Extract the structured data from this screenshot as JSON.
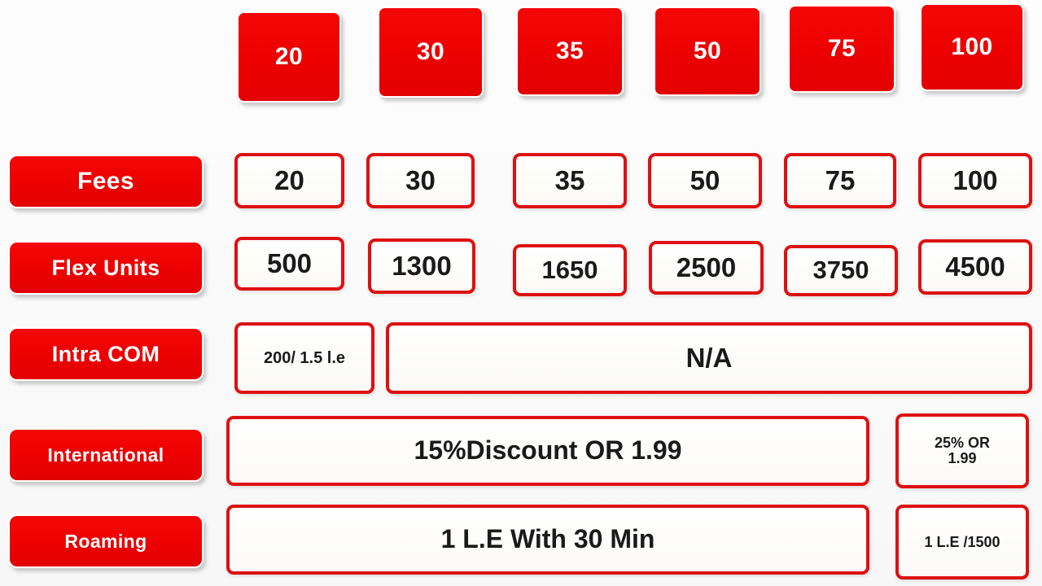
{
  "meta": {
    "colors": {
      "red": "#EE0000",
      "border_red": "#DD1111",
      "text_dark": "#1A1A1A",
      "background": "#FCFCFC",
      "chip_text": "#FFFFFF"
    }
  },
  "header": {
    "plans": [
      "20",
      "30",
      "35",
      "50",
      "75",
      "100"
    ]
  },
  "rows": [
    {
      "label": "Fees",
      "values": [
        "20",
        "30",
        "35",
        "50",
        "75",
        "100"
      ]
    },
    {
      "label": "Flex Units",
      "values": [
        "500",
        "1300",
        "1650",
        "2500",
        "3750",
        "4500"
      ]
    },
    {
      "label": "Intra COM",
      "values": [
        "200/ 1.5 l.e",
        "N/A"
      ]
    },
    {
      "label": "International",
      "values": [
        "15%Discount  OR 1.99",
        "25% OR 1.99"
      ]
    },
    {
      "label": "Roaming",
      "values": [
        "1 L.E With 30 Min",
        "1 L.E /1500"
      ]
    }
  ],
  "intra_com": {
    "first": "200/ 1.5 l.e",
    "rest": "N/A"
  },
  "international": {
    "main": "15%Discount  OR 1.99",
    "last_line1": "25% OR",
    "last_line2": "1.99"
  },
  "roaming": {
    "main": "1 L.E With 30 Min",
    "last": "1 L.E /1500"
  }
}
